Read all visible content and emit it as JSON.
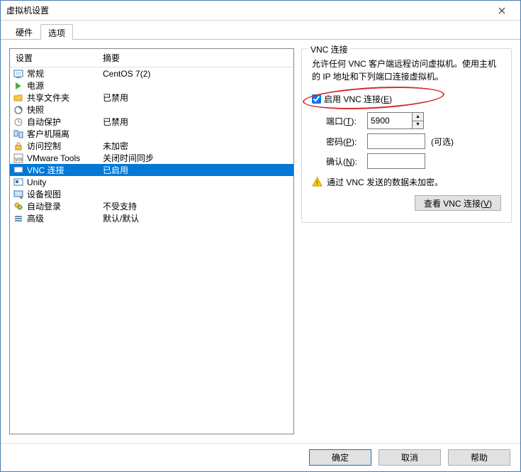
{
  "window": {
    "title": "虚拟机设置"
  },
  "tabs": {
    "hardware": "硬件",
    "options": "选项"
  },
  "headers": {
    "setting": "设置",
    "summary": "摘要"
  },
  "rows": [
    {
      "icon": "general",
      "label": "常规",
      "summary": "CentOS 7(2)"
    },
    {
      "icon": "power",
      "label": "电源",
      "summary": ""
    },
    {
      "icon": "shared",
      "label": "共享文件夹",
      "summary": "已禁用"
    },
    {
      "icon": "snapshot",
      "label": "快照",
      "summary": ""
    },
    {
      "icon": "autoprot",
      "label": "自动保护",
      "summary": "已禁用"
    },
    {
      "icon": "guestiso",
      "label": "客户机隔离",
      "summary": ""
    },
    {
      "icon": "access",
      "label": "访问控制",
      "summary": "未加密"
    },
    {
      "icon": "vmtools",
      "label": "VMware Tools",
      "summary": "关闭时间同步"
    },
    {
      "icon": "vnc",
      "label": "VNC 连接",
      "summary": "已启用"
    },
    {
      "icon": "unity",
      "label": "Unity",
      "summary": ""
    },
    {
      "icon": "devview",
      "label": "设备视图",
      "summary": ""
    },
    {
      "icon": "autologin",
      "label": "自动登录",
      "summary": "不受支持"
    },
    {
      "icon": "advanced",
      "label": "高级",
      "summary": "默认/默认"
    }
  ],
  "right": {
    "legend": "VNC 连接",
    "desc": "允许任何 VNC 客户端远程访问虚拟机。使用主机的 IP 地址和下列端口连接虚拟机。",
    "enable_label_pre": "启用 VNC 连接(",
    "enable_label_hot": "E",
    "enable_label_post": ")",
    "port_label_pre": "端口(",
    "port_label_hot": "T",
    "port_label_post": "):",
    "port_value": "5900",
    "pwd_label_pre": "密码(",
    "pwd_label_hot": "P",
    "pwd_label_post": "):",
    "pwd_value": "",
    "optional": "(可选)",
    "conf_label_pre": "确认(",
    "conf_label_hot": "N",
    "conf_label_post": "):",
    "conf_value": "",
    "warn_text": "通过 VNC 发送的数据未加密。",
    "view_btn_pre": "查看 VNC 连接(",
    "view_btn_hot": "V",
    "view_btn_post": ")"
  },
  "footer": {
    "ok": "确定",
    "cancel": "取消",
    "help": "帮助"
  }
}
